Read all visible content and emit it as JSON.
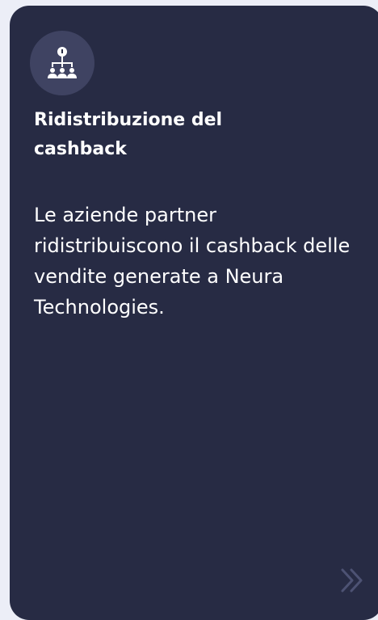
{
  "card": {
    "icon": "hierarchy-icon",
    "title": "Ridistribuzione del cashback",
    "description": "Le aziende partner ridistribuiscono il cashback delle vendite generate a Neura Technologies.",
    "next_icon": "double-chevron-right-icon"
  },
  "colors": {
    "page_background": "#eceef7",
    "card_background": "#272b44",
    "icon_circle": "#3f4362",
    "text": "#ffffff",
    "chevron": "#4d5273"
  }
}
